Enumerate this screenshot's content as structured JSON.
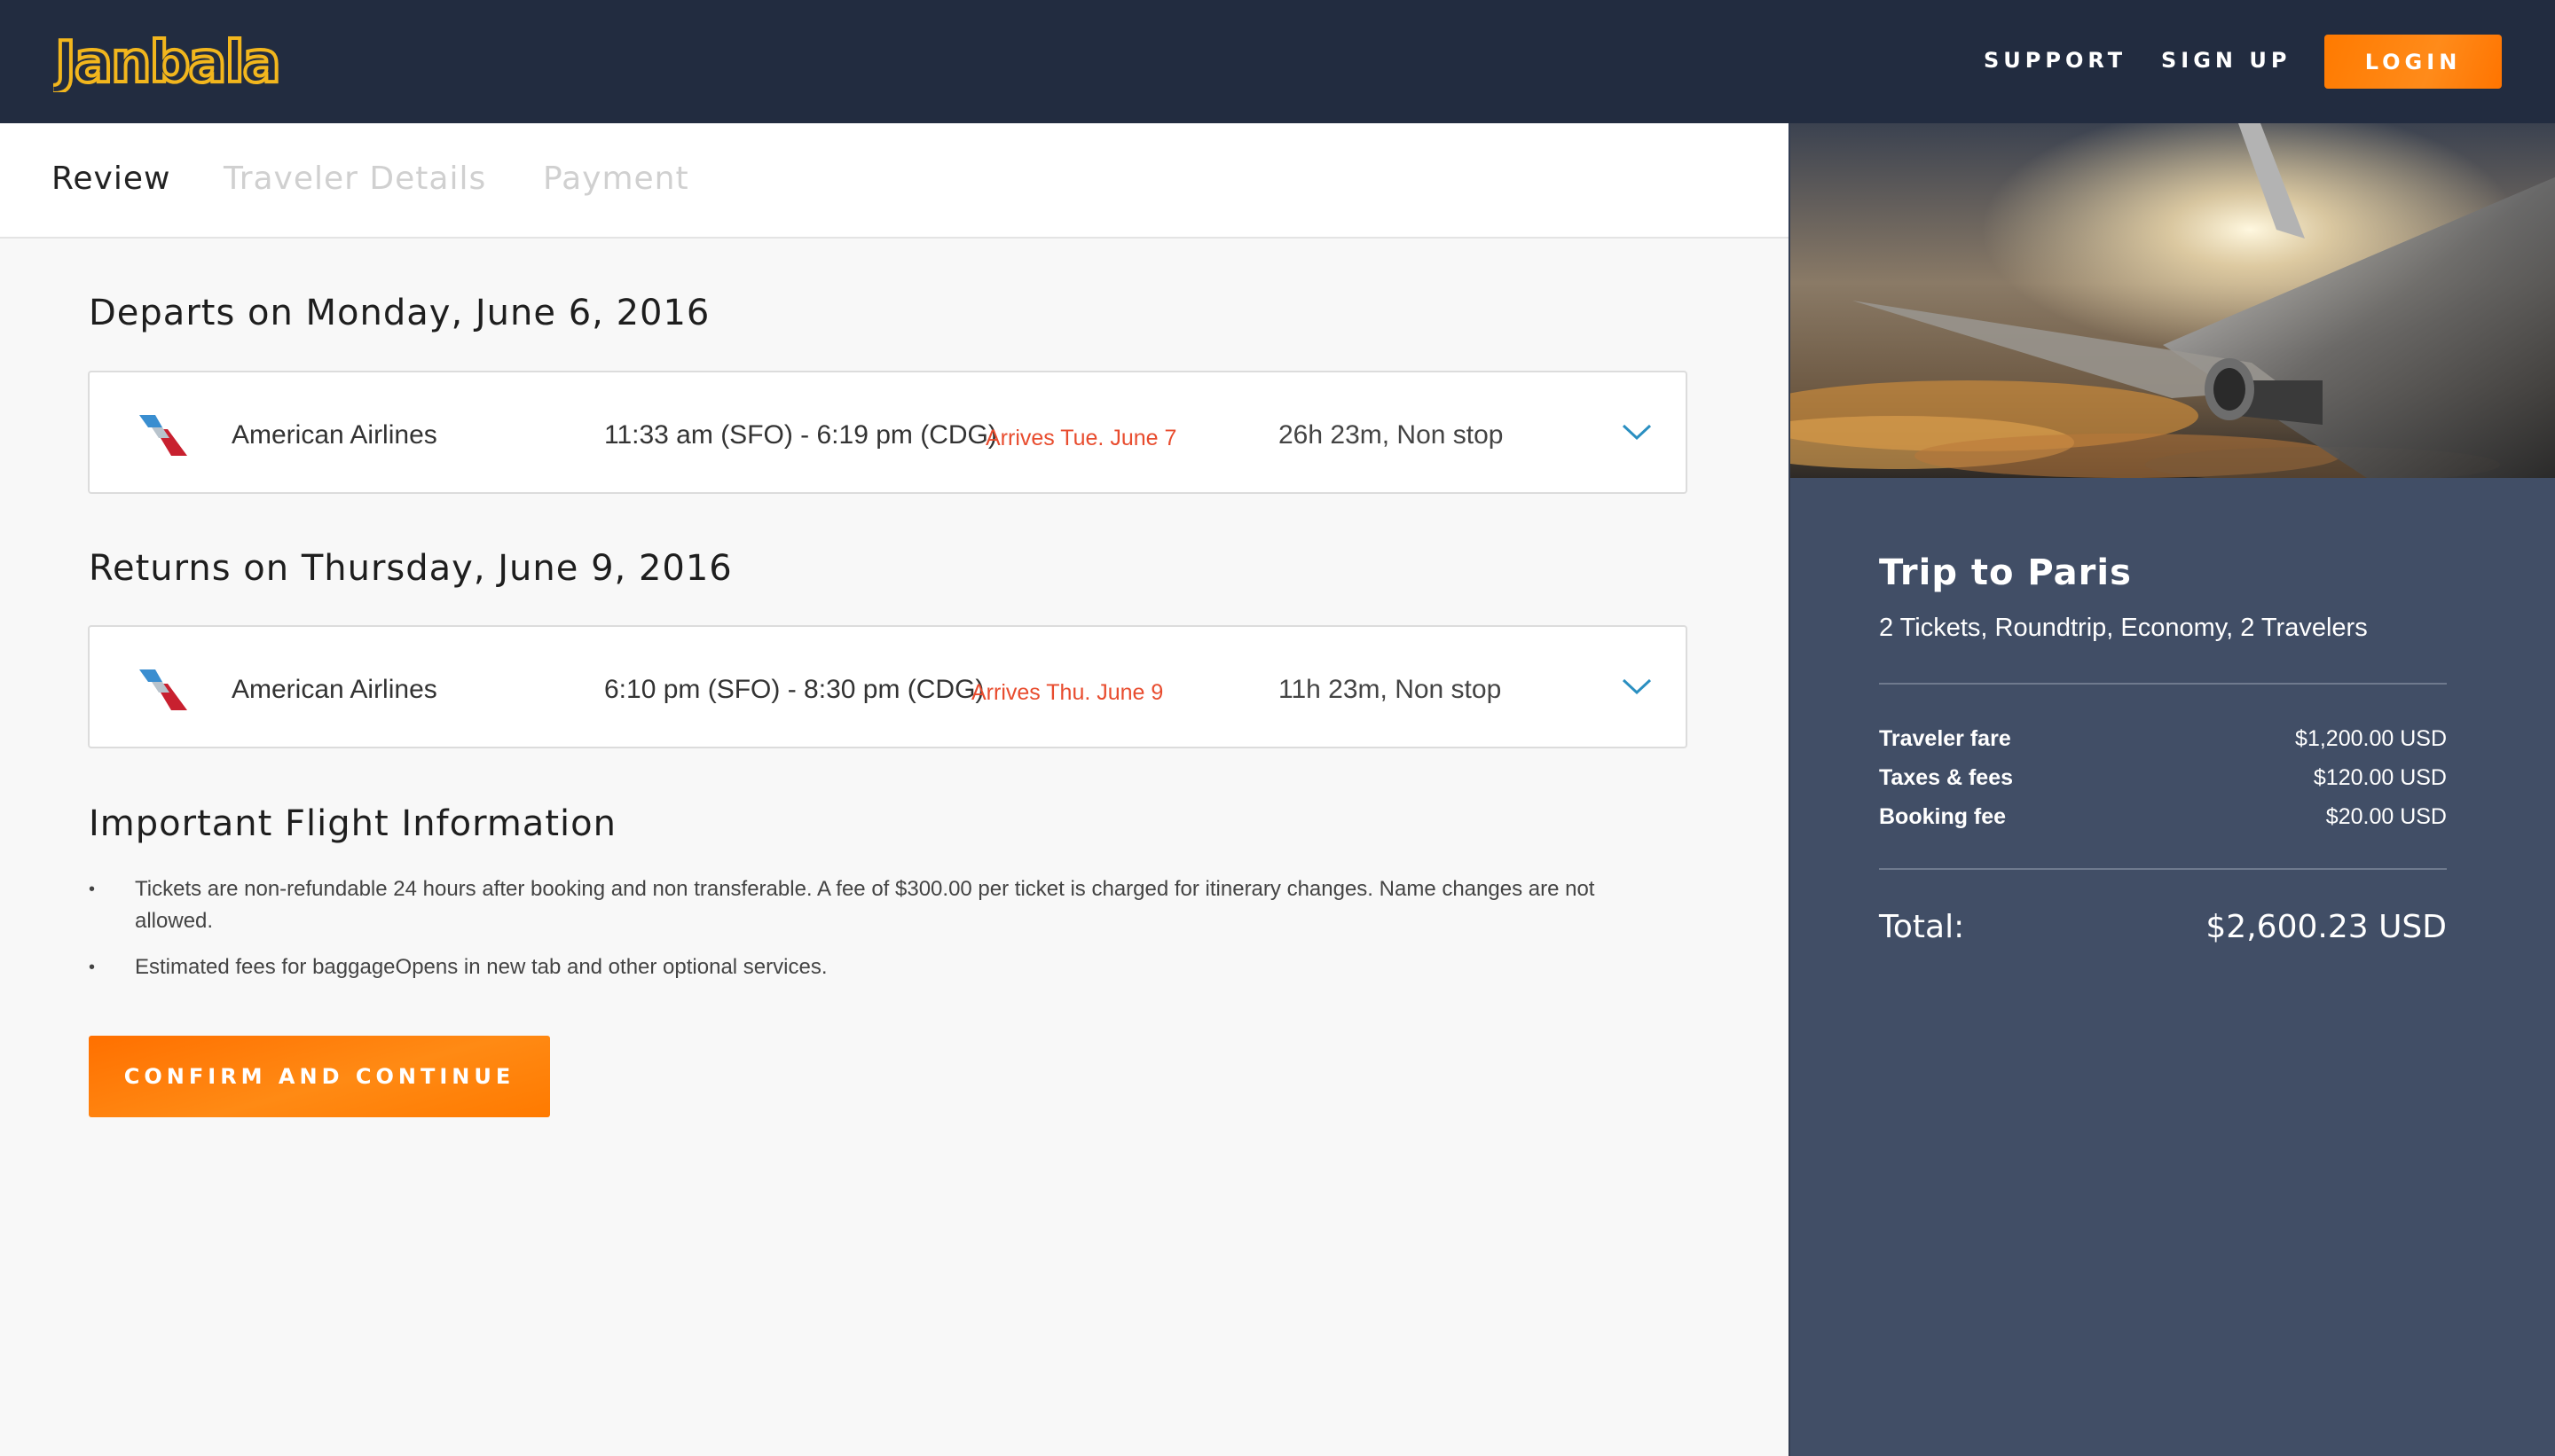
{
  "header": {
    "brand": "Janbala",
    "nav": {
      "support": "SUPPORT",
      "signup": "SIGN UP",
      "login": "LOGIN"
    }
  },
  "steps": {
    "review": "Review",
    "traveler": "Traveler Details",
    "payment": "Payment"
  },
  "departure": {
    "title": "Departs on Monday, June 6, 2016",
    "airline": "American Airlines",
    "times": "11:33 am (SFO) - 6:19 pm (CDG)",
    "arrives": "Arrives Tue. June 7",
    "duration": "26h 23m, Non stop"
  },
  "return_flight": {
    "title": "Returns on Thursday, June 9, 2016",
    "airline": "American Airlines",
    "times": "6:10 pm (SFO) - 8:30 pm (CDG)",
    "arrives": "Arrives Thu. June 9",
    "duration": "11h 23m, Non stop"
  },
  "info": {
    "title": "Important Flight Information",
    "items": [
      "Tickets are non-refundable 24 hours after booking and non transferable. A fee of $300.00 per ticket is charged for itinerary changes. Name changes are not allowed.",
      "Estimated fees for baggageOpens in new tab and other optional services."
    ]
  },
  "confirm_label": "CONFIRM AND CONTINUE",
  "summary": {
    "title": "Trip to Paris",
    "subtitle": "2 Tickets, Roundtrip, Economy, 2 Travelers",
    "rows": [
      {
        "label": "Traveler fare",
        "value": "$1,200.00 USD"
      },
      {
        "label": "Taxes & fees",
        "value": "$120.00 USD"
      },
      {
        "label": "Booking fee",
        "value": "$20.00 USD"
      }
    ],
    "total_label": "Total:",
    "total_value": "$2,600.23 USD"
  },
  "colors": {
    "header_bg": "#222c40",
    "accent_orange": "#ff7a00",
    "logo_yellow": "#f2b61d",
    "side_bg": "#414e66",
    "arrives_red": "#e84c2e",
    "chevron_blue": "#2a8fc1"
  }
}
